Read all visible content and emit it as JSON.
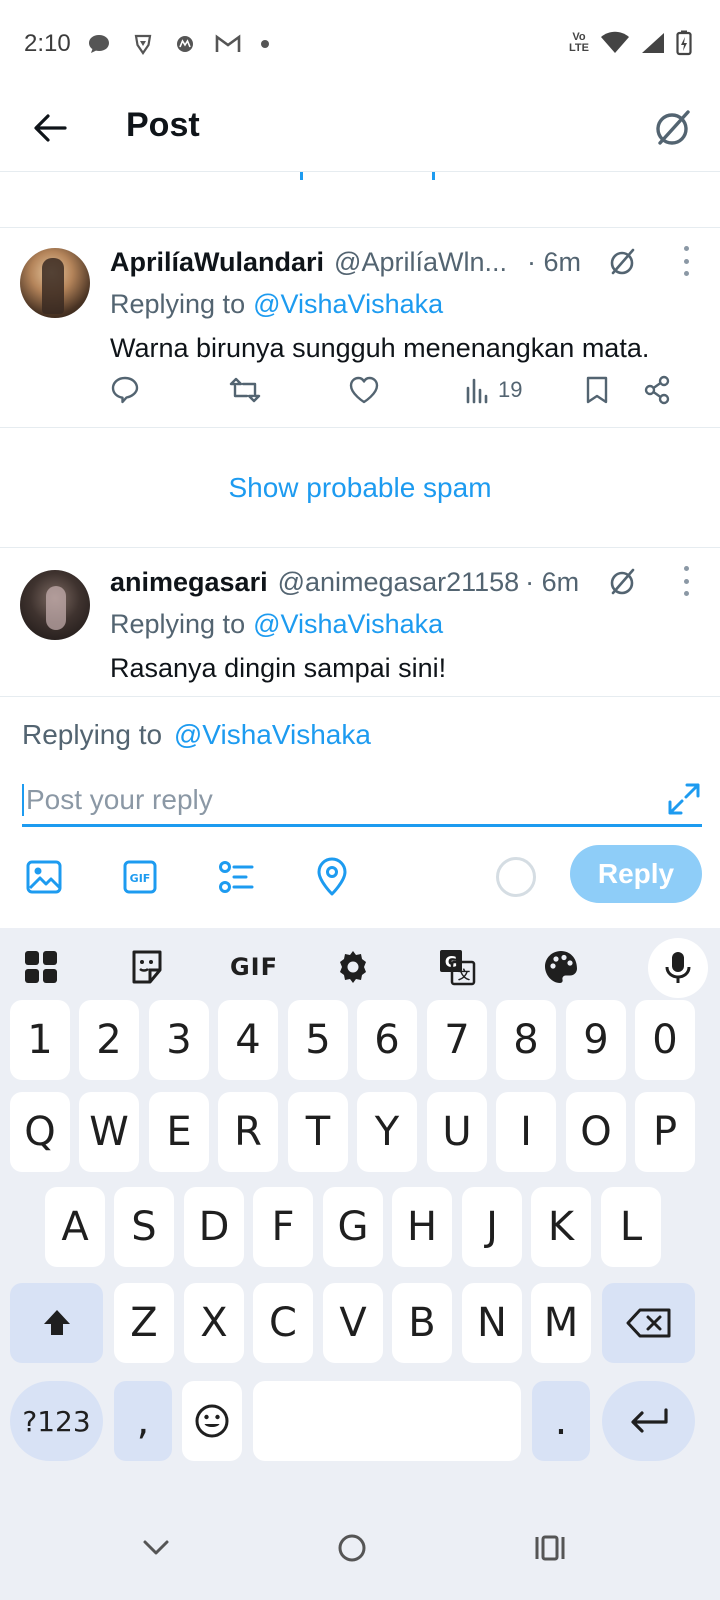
{
  "status_bar": {
    "time": "2:10",
    "lte_label": "Vo LTE",
    "left_icons": [
      "chat-icon",
      "brave-icon",
      "motorola-icon",
      "gmail-icon",
      "dot-icon"
    ],
    "right_icons": [
      "volte-icon",
      "wifi-icon",
      "signal-icon",
      "battery-charging-icon"
    ]
  },
  "header": {
    "title": "Post"
  },
  "tweets": [
    {
      "display_name": "AprilíaWulandari",
      "handle": "@AprilíaWln...",
      "time": "· 6m",
      "replying_prefix": "Replying to",
      "replying_handle": "@VishaVishaka",
      "text": "Warna birunya sungguh menenangkan mata.",
      "views": "19"
    },
    {
      "display_name": "animegasari",
      "handle": "@animegasar21158",
      "time": "· 6m",
      "replying_prefix": "Replying to",
      "replying_handle": "@VishaVishaka",
      "text": "Rasanya dingin sampai sini!"
    }
  ],
  "spam": {
    "label": "Show probable spam"
  },
  "composer": {
    "replying_prefix": "Replying to",
    "replying_handle": "@VishaVishaka",
    "placeholder": "Post your reply",
    "reply_button": "Reply"
  },
  "keyboard": {
    "toolbar_gif": "GIF",
    "number_row": [
      "1",
      "2",
      "3",
      "4",
      "5",
      "6",
      "7",
      "8",
      "9",
      "0"
    ],
    "row1": [
      "Q",
      "W",
      "E",
      "R",
      "T",
      "Y",
      "U",
      "I",
      "O",
      "P"
    ],
    "row2": [
      "A",
      "S",
      "D",
      "F",
      "G",
      "H",
      "J",
      "K",
      "L"
    ],
    "row3": [
      "Z",
      "X",
      "C",
      "V",
      "B",
      "N",
      "M"
    ],
    "symbols_key": "?123",
    "comma_key": ",",
    "period_key": "."
  },
  "colors": {
    "accent": "#1d9bf0",
    "reply_button_disabled": "#8ecdf8",
    "keyboard_bg": "#eceff5",
    "special_key": "#d8e2f5"
  }
}
